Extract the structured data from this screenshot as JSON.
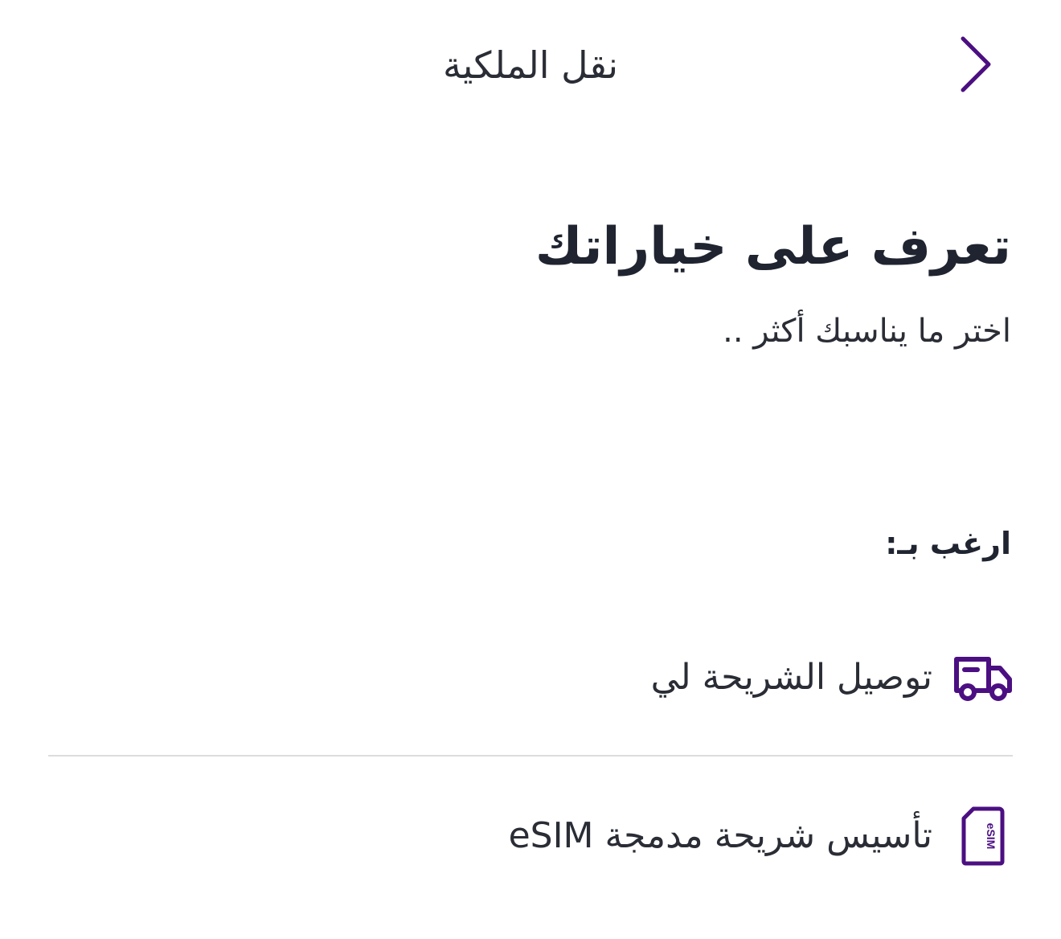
{
  "header": {
    "title": "نقل الملكية",
    "back_icon": "chevron-right-icon"
  },
  "intro": {
    "heading": "تعرف على خياراتك",
    "subheading": "اختر ما يناسبك أكثر .."
  },
  "section": {
    "label": "ارغب بـ:"
  },
  "options": [
    {
      "label": "توصيل الشريحة لي",
      "icon": "delivery-truck-icon"
    },
    {
      "label": "تأسيس شريحة مدمجة eSIM",
      "icon": "esim-card-icon",
      "icon_text": "eSIM"
    }
  ],
  "colors": {
    "accent": "#4b0f82",
    "text": "#1f2430",
    "divider": "#dcdcdc",
    "background": "#ffffff"
  }
}
